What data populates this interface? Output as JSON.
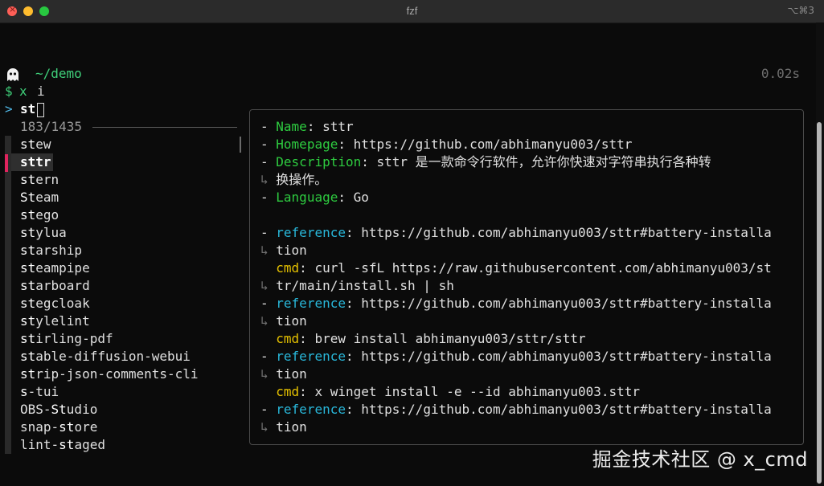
{
  "window": {
    "title": "fzf",
    "shortcut": "⌥⌘3"
  },
  "prompt": {
    "path": "~/demo",
    "elapsed": "0.02s",
    "dollar": "$",
    "command_x": "x",
    "command_arg": "i",
    "fzf_prompt": ">",
    "query": "st"
  },
  "match_count": "183/1435",
  "results": [
    {
      "pre": "",
      "hl": "st",
      "post": "ew"
    },
    {
      "pre": "",
      "hl": "st",
      "post": "tr"
    },
    {
      "pre": "",
      "hl": "st",
      "post": "ern"
    },
    {
      "pre": "",
      "hl": "St",
      "post": "eam"
    },
    {
      "pre": "",
      "hl": "st",
      "post": "ego"
    },
    {
      "pre": "",
      "hl": "st",
      "post": "ylua"
    },
    {
      "pre": "",
      "hl": "st",
      "post": "arship"
    },
    {
      "pre": "",
      "hl": "st",
      "post": "eampipe"
    },
    {
      "pre": "",
      "hl": "st",
      "post": "arboard"
    },
    {
      "pre": "",
      "hl": "st",
      "post": "egcloak"
    },
    {
      "pre": "",
      "hl": "st",
      "post": "ylelint"
    },
    {
      "pre": "",
      "hl": "st",
      "post": "irling-pdf"
    },
    {
      "pre": "",
      "hl": "st",
      "post": "able-diffusion-webui"
    },
    {
      "pre": "",
      "hl": "st",
      "post": "rip-json-comments-cli"
    },
    {
      "pre": "",
      "hl": "s",
      "post": "-tui"
    },
    {
      "pre": "OBS-",
      "hl": "St",
      "post": "udio"
    },
    {
      "pre": "snap-",
      "hl": "st",
      "post": "ore"
    },
    {
      "pre": "lint-",
      "hl": "st",
      "post": "aged"
    }
  ],
  "selected_index": 1,
  "preview": {
    "name_key": "Name",
    "name_val": "sttr",
    "homepage_key": "Homepage",
    "homepage_val": "https://github.com/abhimanyu003/sttr",
    "description_key": "Description",
    "description_line1": "sttr 是一款命令行软件，允许你快速对字符串执行各种转",
    "description_line2": "换操作。",
    "language_key": "Language",
    "language_val": "Go",
    "reference_key": "reference",
    "cmd_key": "cmd",
    "ref_url_part1": "https://github.com/abhimanyu003/sttr#battery-installa",
    "ref_url_part2": "tion",
    "cmd1_part1": "curl -sfL https://raw.githubusercontent.com/abhimanyu003/st",
    "cmd1_part2": "tr/main/install.sh | sh",
    "cmd2": "brew install abhimanyu003/sttr/sttr",
    "cmd3": "x winget install -e --id abhimanyu003.sttr",
    "dash": "-",
    "wrap_marker": "↳"
  },
  "watermark": "掘金技术社区 @ x_cmd",
  "colors": {
    "green": "#2ecc40",
    "cyan": "#29b8db",
    "yellow": "#e5c100",
    "selection_marker": "#e0245e"
  }
}
